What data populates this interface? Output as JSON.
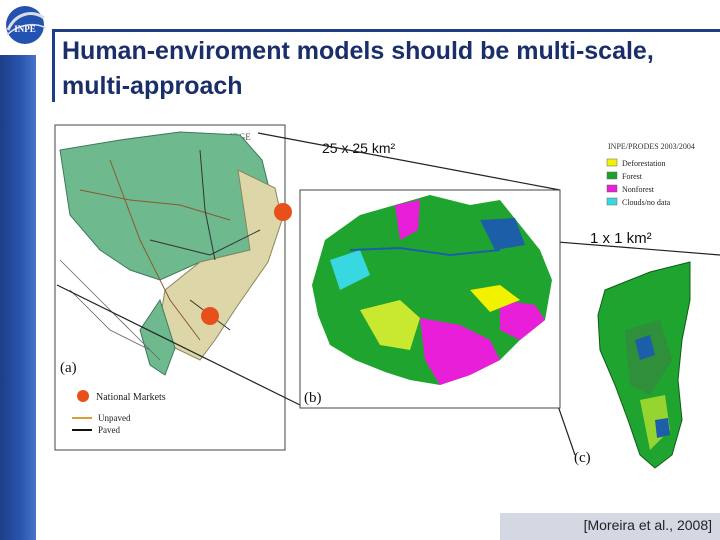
{
  "title": "Human-enviroment models should be multi-scale, multi-approach",
  "logo_text": "INPE",
  "scale_labels": {
    "coarse": "25 x 25 km²",
    "fine": "1 x 1 km²"
  },
  "panel_labels": {
    "a": "(a)",
    "b": "(b)",
    "c": "(c)"
  },
  "map_a": {
    "source": "Source: IBGE",
    "legend": [
      {
        "label": "National Markets",
        "color": "#e8501a"
      },
      {
        "label": "Unpaved",
        "color": "#d9a030"
      },
      {
        "label": "Paved",
        "color": "#111111"
      }
    ]
  },
  "map_b": {
    "source": "INPE/PRODES 2003/2004",
    "legend": [
      {
        "label": "Deforestation",
        "color": "#f2f200"
      },
      {
        "label": "Forest",
        "color": "#1e9e2e"
      },
      {
        "label": "Nonforest",
        "color": "#e81ed8"
      },
      {
        "label": "Clouds/no data",
        "color": "#38d8e0"
      }
    ]
  },
  "citation": "[Moreira et al., 2008]",
  "colors": {
    "accent": "#1d3d88",
    "title": "#1a2e6a"
  }
}
